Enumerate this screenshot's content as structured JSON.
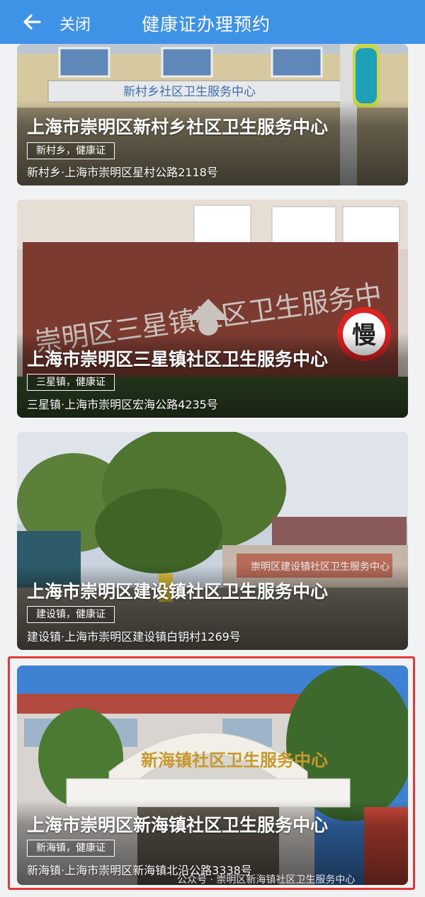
{
  "topbar": {
    "close_label": "关闭",
    "title": "健康证办理预约",
    "bg_color": "#3f93e6"
  },
  "cards": [
    {
      "title": "上海市崇明区新村乡社区卫生服务中心",
      "tag": "新村乡，健康证",
      "address": "新村乡·上海市崇明区星村公路2118号",
      "sign_text": "新村乡社区卫生服务中心"
    },
    {
      "title": "上海市崇明区三星镇社区卫生服务中心",
      "tag": "三星镇，健康证",
      "address": "三星镇·上海市崇明区宏海公路4235号",
      "sign_text": "崇明区三星镇社区卫生服务中",
      "road_sign_text": "慢"
    },
    {
      "title": "上海市崇明区建设镇社区卫生服务中心",
      "tag": "建设镇，健康证",
      "address": "建设镇·上海市崇明区建设镇白钥村1269号",
      "sign_text": "崇明区建设镇社区卫生服务中心"
    },
    {
      "title": "上海市崇明区新海镇社区卫生服务中心",
      "tag": "新海镇，健康证",
      "address": "新海镇·上海市崇明区新海镇北沿公路3338号",
      "sign_text": "新海镇社区卫生服务中心"
    }
  ],
  "watermark": "公众号 · 崇明区新海镇社区卫生服务中心",
  "highlight_color": "#e53935"
}
